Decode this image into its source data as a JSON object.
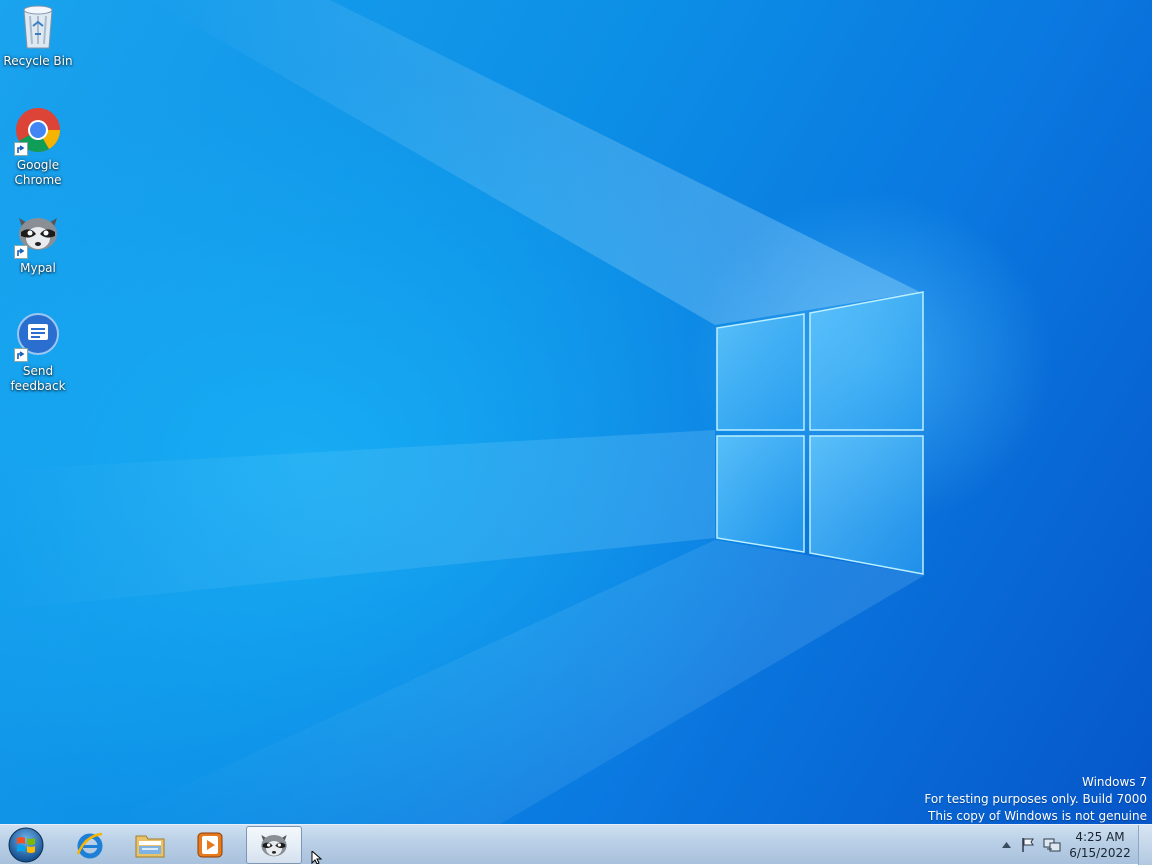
{
  "desktop": {
    "icons": [
      {
        "label": "Recycle Bin",
        "icon": "recycle-bin-icon"
      },
      {
        "label": "Google Chrome",
        "icon": "chrome-icon"
      },
      {
        "label": "Mypal",
        "icon": "mypal-raccoon-icon"
      },
      {
        "label": "Send feedback",
        "icon": "feedback-icon"
      }
    ],
    "watermark": {
      "line1": "Windows  7",
      "line2": "For testing purposes only. Build 7000",
      "line3": "This copy of Windows is not genuine"
    }
  },
  "taskbar": {
    "start": {
      "icon": "windows-start-orb-icon"
    },
    "pinned": [
      {
        "icon": "internet-explorer-icon"
      },
      {
        "icon": "file-explorer-icon"
      },
      {
        "icon": "media-player-icon"
      },
      {
        "icon": "mypal-raccoon-icon",
        "active": true
      }
    ],
    "tray": {
      "icons": [
        "show-hidden-icons-chevron",
        "action-center-flag-icon",
        "network-icon"
      ],
      "time": "4:25 AM",
      "date": "6/15/2022"
    }
  },
  "colors": {
    "wallpaper_light": "#1aa3ee",
    "wallpaper_dark": "#0656c9",
    "taskbar": "#b9cfe6"
  }
}
